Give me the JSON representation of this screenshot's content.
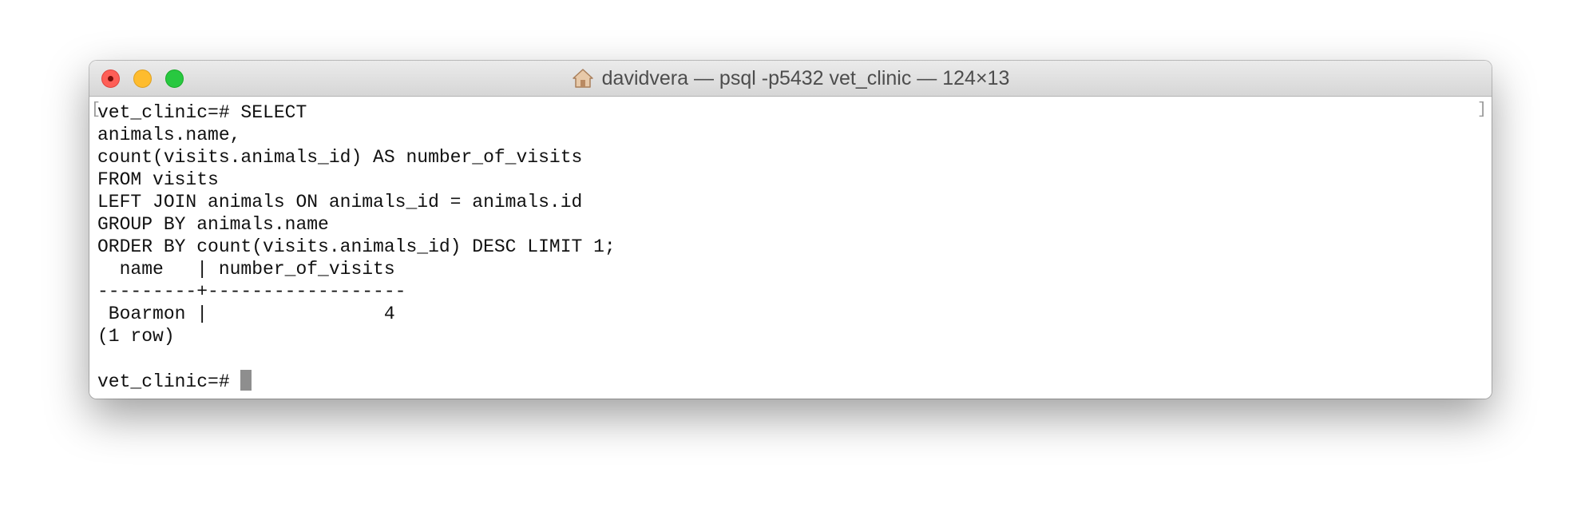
{
  "window": {
    "title": "davidvera — psql -p5432 vet_clinic — 124×13",
    "title_icon": "home-icon"
  },
  "traffic_lights": {
    "close_color": "#fe5f57",
    "minimize_color": "#febc2e",
    "zoom_color": "#28c840"
  },
  "terminal": {
    "marks": {
      "left": "[",
      "right": "]"
    },
    "lines": [
      "vet_clinic=# SELECT",
      "animals.name,",
      "count(visits.animals_id) AS number_of_visits",
      "FROM visits",
      "LEFT JOIN animals ON animals_id = animals.id",
      "GROUP BY animals.name",
      "ORDER BY count(visits.animals_id) DESC LIMIT 1;",
      "  name   | number_of_visits",
      "---------+------------------",
      " Boarmon |                4",
      "(1 row)",
      "",
      "vet_clinic=# "
    ],
    "cursor_color": "#8e8e8e"
  }
}
